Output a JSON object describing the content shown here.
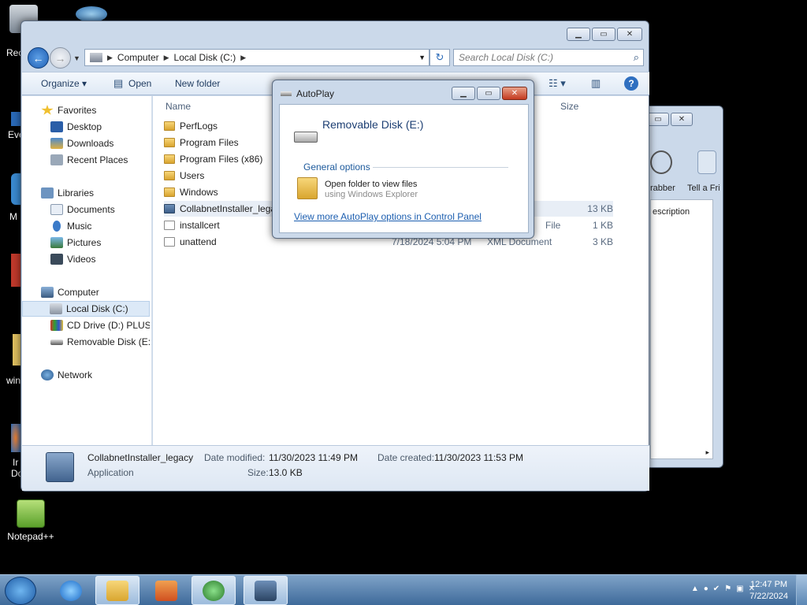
{
  "desktop": {
    "icons": [
      {
        "label": "Notepad++"
      }
    ],
    "partial_labels": [
      "Rec",
      "Eve",
      "M",
      "win",
      "Ir",
      "Do"
    ]
  },
  "explorer": {
    "address": {
      "crumbs": [
        "Computer",
        "Local Disk (C:)"
      ]
    },
    "search_placeholder": "Search Local Disk (C:)",
    "toolbar": {
      "organize": "Organize",
      "open": "Open",
      "new_folder": "New folder"
    },
    "nav": {
      "favorites": "Favorites",
      "desktop": "Desktop",
      "downloads": "Downloads",
      "recent": "Recent Places",
      "libraries": "Libraries",
      "documents": "Documents",
      "music": "Music",
      "pictures": "Pictures",
      "videos": "Videos",
      "computer": "Computer",
      "local_disk": "Local Disk (C:)",
      "cd_drive": "CD Drive (D:) PLUS98",
      "removable": "Removable Disk (E:)",
      "network": "Network"
    },
    "columns": {
      "name": "Name",
      "size": "Size"
    },
    "files": [
      {
        "name": "PerfLogs",
        "date": "",
        "type": "",
        "size": "",
        "kind": "folder"
      },
      {
        "name": "Program Files",
        "date": "",
        "type": "",
        "size": "",
        "kind": "folder"
      },
      {
        "name": "Program Files (x86)",
        "date": "",
        "type": "",
        "size": "",
        "kind": "folder"
      },
      {
        "name": "Users",
        "date": "",
        "type": "",
        "size": "",
        "kind": "folder"
      },
      {
        "name": "Windows",
        "date": "",
        "type": "",
        "size": "",
        "kind": "folder"
      },
      {
        "name": "CollabnetInstaller_legacy",
        "date": "",
        "type": "",
        "size": "13 KB",
        "kind": "app"
      },
      {
        "name": "installcert",
        "date": "",
        "type": "File",
        "size": "1 KB",
        "kind": "doc"
      },
      {
        "name": "unattend",
        "date": "7/18/2024 5:04 PM",
        "type": "XML Document",
        "size": "3 KB",
        "kind": "doc"
      }
    ],
    "details": {
      "name": "CollabnetInstaller_legacy",
      "kind": "Application",
      "modified_label": "Date modified:",
      "modified_value": "11/30/2023 11:49 PM",
      "created_label": "Date created:",
      "created_value": "11/30/2023 11:53 PM",
      "size_label": "Size:",
      "size_value": "13.0 KB"
    }
  },
  "background_window": {
    "labels": [
      "rabber",
      "Tell a Fri",
      "escription"
    ]
  },
  "autoplay": {
    "title": "AutoPlay",
    "device": "Removable Disk (E:)",
    "group": "General options",
    "option_title": "Open folder to view files",
    "option_sub": "using Windows Explorer",
    "more_link": "View more AutoPlay options in Control Panel"
  },
  "taskbar": {
    "time": "12:47 PM",
    "date": "7/22/2024"
  }
}
